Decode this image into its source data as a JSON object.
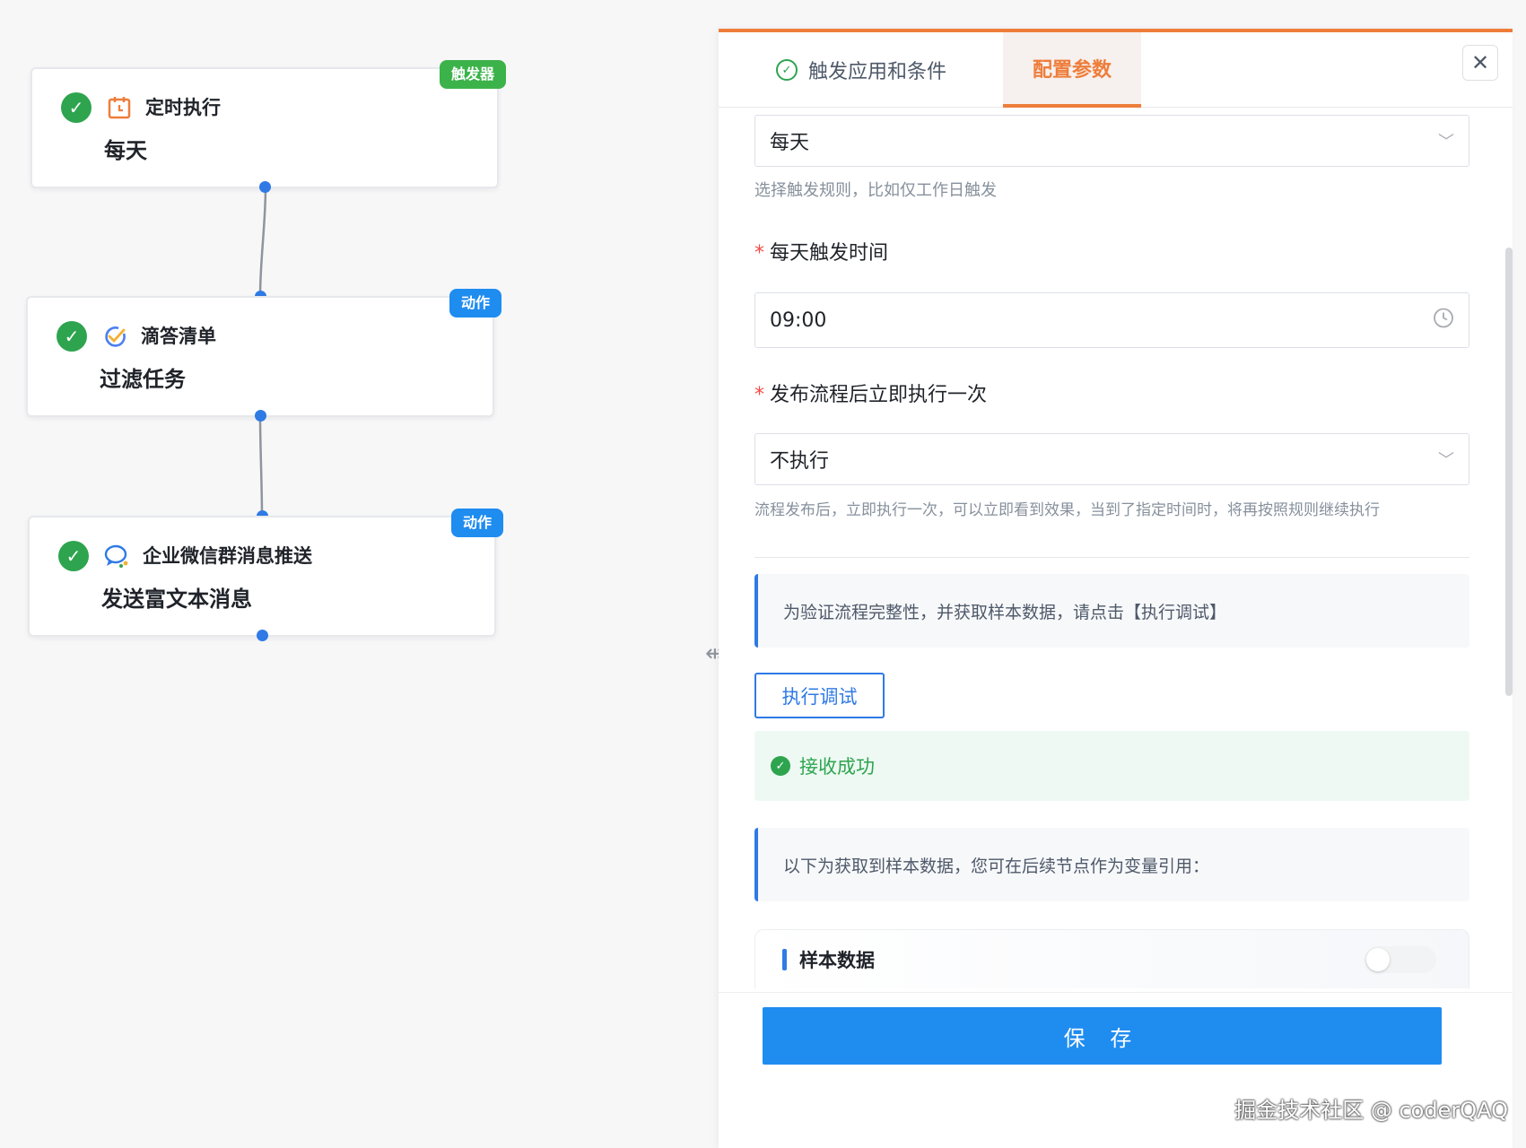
{
  "flow": {
    "nodes": [
      {
        "app_name": "定时执行",
        "desc": "每天",
        "badge": "触发器",
        "app_icon": "calendar-icon"
      },
      {
        "app_name": "滴答清单",
        "desc": "过滤任务",
        "badge": "动作",
        "app_icon": "checklist-icon"
      },
      {
        "app_name": "企业微信群消息推送",
        "desc": "发送富文本消息",
        "badge": "动作",
        "app_icon": "chat-bubble-icon"
      }
    ],
    "colors": {
      "trigger_badge": "#3cb34a",
      "action_badge": "#1f8cf0",
      "done_check": "#2ea44f"
    }
  },
  "panel": {
    "tabs": [
      {
        "label": "触发应用和条件",
        "done": true
      },
      {
        "label": "配置参数",
        "active": true
      }
    ],
    "accent": "#ee7d3a",
    "trigger_rule": {
      "value": "每天",
      "hint": "选择触发规则，比如仅工作日触发"
    },
    "daily_time": {
      "label": "每天触发时间",
      "value": "09:00"
    },
    "run_once": {
      "label": "发布流程后立即执行一次",
      "value": "不执行",
      "hint": "流程发布后，立即执行一次，可以立即看到效果，当到了指定时间时，将再按照规则继续执行"
    },
    "debug_notice": "为验证流程完整性，并获取样本数据，请点击【执行调试】",
    "debug_button": "执行调试",
    "success_text": "接收成功",
    "sample_notice": "以下为获取到样本数据，您可在后续节点作为变量引用：",
    "sample_title": "样本数据",
    "save_button": "保 存"
  },
  "watermark": "掘金技术社区 @ coderQAQ"
}
